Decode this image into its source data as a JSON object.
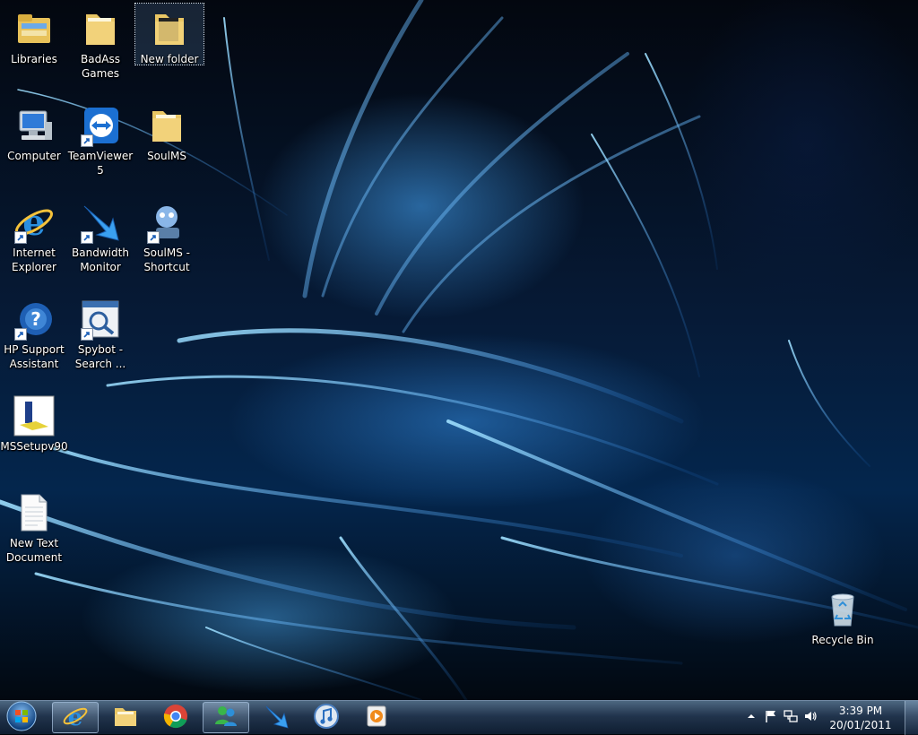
{
  "desktop": {
    "icons": [
      {
        "label": "Libraries",
        "icon": "libraries-icon"
      },
      {
        "label": "BadAss\nGames",
        "icon": "folder-icon"
      },
      {
        "label": "New folder",
        "icon": "folder-icon",
        "selected": true
      },
      {
        "label": "Computer",
        "icon": "computer-icon"
      },
      {
        "label": "TeamViewer\n5",
        "icon": "teamviewer-icon",
        "shortcut": true
      },
      {
        "label": "SoulMS",
        "icon": "folder-icon"
      },
      {
        "label": "Internet\nExplorer",
        "icon": "internet-explorer-icon",
        "shortcut": true
      },
      {
        "label": "Bandwidth\nMonitor",
        "icon": "bandwidth-monitor-icon",
        "shortcut": true
      },
      {
        "label": "SoulMS -\nShortcut",
        "icon": "soulms-icon",
        "shortcut": true
      },
      {
        "label": "HP Support\nAssistant",
        "icon": "hp-support-icon",
        "shortcut": true
      },
      {
        "label": "Spybot -\nSearch ...",
        "icon": "spybot-icon",
        "shortcut": true
      },
      {
        "label": "MSSetupv90",
        "icon": "mssetup-icon"
      },
      {
        "label": "New Text\nDocument",
        "icon": "text-document-icon"
      },
      {
        "label": "Recycle Bin",
        "icon": "recycle-bin-icon"
      }
    ]
  },
  "taskbar": {
    "start": {
      "icon": "windows-start-icon"
    },
    "buttons": [
      {
        "name": "internet-explorer",
        "icon": "internet-explorer-icon",
        "active": true
      },
      {
        "name": "windows-explorer",
        "icon": "folder-icon"
      },
      {
        "name": "google-chrome",
        "icon": "chrome-icon"
      },
      {
        "name": "windows-live-messenger",
        "icon": "messenger-icon"
      },
      {
        "name": "bandwidth-monitor",
        "icon": "bandwidth-monitor-icon"
      },
      {
        "name": "itunes",
        "icon": "itunes-icon"
      },
      {
        "name": "media-player",
        "icon": "media-player-icon"
      }
    ],
    "tray": {
      "icons": [
        "show-hidden-icons-arrow",
        "action-center-flag-icon",
        "network-icon",
        "volume-icon"
      ],
      "time": "3:39 PM",
      "date": "20/01/2011"
    }
  },
  "colors": {
    "wallpaper_dark": "#02040a",
    "wallpaper_glow": "#46aaff",
    "taskbar": "#233750",
    "label_text": "#ffffff"
  }
}
